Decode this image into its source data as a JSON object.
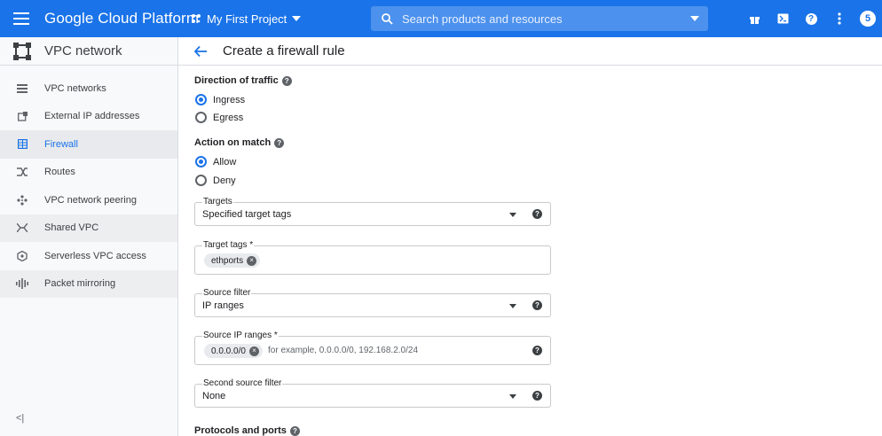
{
  "topbar": {
    "brand": "Google Cloud Platform",
    "project": "My First Project",
    "search_placeholder": "Search products and resources",
    "avatar_letter": "5",
    "bg_color": "#1a73e8"
  },
  "sidebar": {
    "title": "VPC network",
    "items": [
      {
        "label": "VPC networks",
        "icon": "vpc-networks-icon"
      },
      {
        "label": "External IP addresses",
        "icon": "external-ip-icon"
      },
      {
        "label": "Firewall",
        "icon": "firewall-icon",
        "active": true
      },
      {
        "label": "Routes",
        "icon": "routes-icon"
      },
      {
        "label": "VPC network peering",
        "icon": "peering-icon"
      },
      {
        "label": "Shared VPC",
        "icon": "shared-vpc-icon"
      },
      {
        "label": "Serverless VPC access",
        "icon": "serverless-icon"
      },
      {
        "label": "Packet mirroring",
        "icon": "packet-mirroring-icon"
      }
    ],
    "collapse_label": "<|"
  },
  "page": {
    "title": "Create a firewall rule"
  },
  "form": {
    "direction": {
      "label": "Direction of traffic",
      "options": [
        "Ingress",
        "Egress"
      ],
      "selected": "Ingress"
    },
    "action": {
      "label": "Action on match",
      "options": [
        "Allow",
        "Deny"
      ],
      "selected": "Allow"
    },
    "targets": {
      "label": "Targets",
      "value": "Specified target tags"
    },
    "target_tags": {
      "label": "Target tags *",
      "chip": "ethports"
    },
    "source_filter": {
      "label": "Source filter",
      "value": "IP ranges"
    },
    "source_ip_ranges": {
      "label": "Source IP ranges *",
      "chip": "0.0.0.0/0",
      "placeholder": "for example, 0.0.0.0/0, 192.168.2.0/24"
    },
    "second_source_filter": {
      "label": "Second source filter",
      "value": "None"
    },
    "protocols": {
      "label": "Protocols and ports"
    }
  }
}
